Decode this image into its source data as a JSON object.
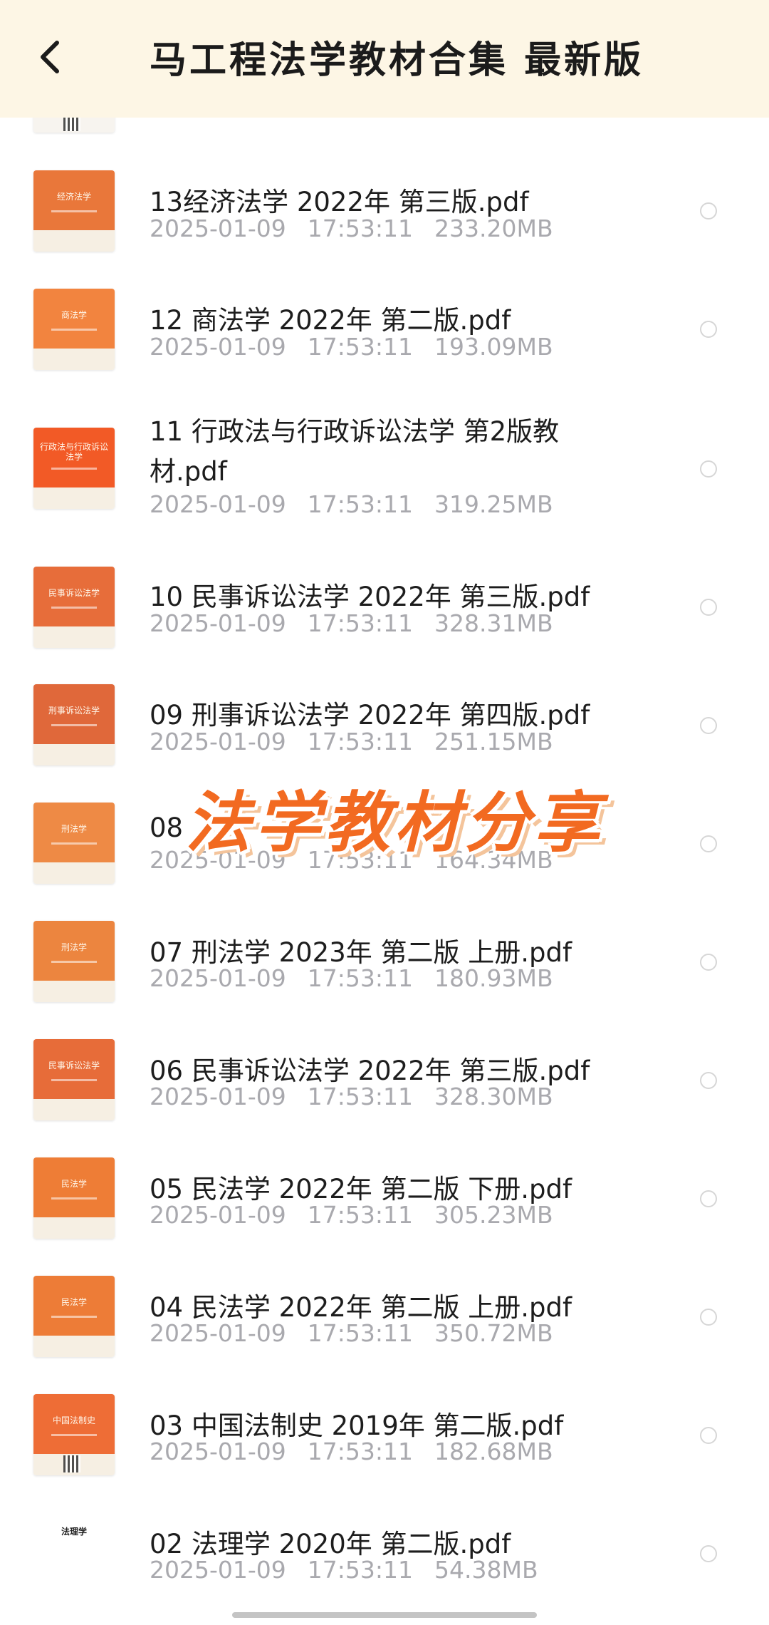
{
  "header": {
    "title": "马工程法学教材合集 最新版",
    "back_icon": "chevron-left-icon"
  },
  "overlay_text": "法学教材分享",
  "files": [
    {
      "name": "13经济法学 2022年 第三版.pdf",
      "date": "2025-01-09",
      "time": "17:53:11",
      "size": "233.20MB",
      "cover_title": "经济法学",
      "cover_color": "#e9773a"
    },
    {
      "name": "12 商法学 2022年 第二版.pdf",
      "date": "2025-01-09",
      "time": "17:53:11",
      "size": "193.09MB",
      "cover_title": "商法学",
      "cover_color": "#f2843f"
    },
    {
      "name": "11 行政法与行政诉讼法学 第2版教材.pdf",
      "date": "2025-01-09",
      "time": "17:53:11",
      "size": "319.25MB",
      "cover_title": "行政法与行政诉讼法学",
      "cover_color": "#f25a26"
    },
    {
      "name": "10 民事诉讼法学 2022年 第三版.pdf",
      "date": "2025-01-09",
      "time": "17:53:11",
      "size": "328.31MB",
      "cover_title": "民事诉讼法学",
      "cover_color": "#e76d3a"
    },
    {
      "name": "09 刑事诉讼法学 2022年 第四版.pdf",
      "date": "2025-01-09",
      "time": "17:53:11",
      "size": "251.15MB",
      "cover_title": "刑事诉讼法学",
      "cover_color": "#e0683a"
    },
    {
      "name": "08",
      "date": "2025-01-09",
      "time": "17:53:11",
      "size": "164.34MB",
      "cover_title": "刑法学",
      "cover_color": "#ee8a45"
    },
    {
      "name": "07 刑法学 2023年 第二版 上册.pdf",
      "date": "2025-01-09",
      "time": "17:53:11",
      "size": "180.93MB",
      "cover_title": "刑法学",
      "cover_color": "#ec853f"
    },
    {
      "name": "06 民事诉讼法学 2022年 第三版.pdf",
      "date": "2025-01-09",
      "time": "17:53:11",
      "size": "328.30MB",
      "cover_title": "民事诉讼法学",
      "cover_color": "#e76c39"
    },
    {
      "name": "05 民法学 2022年 第二版 下册.pdf",
      "date": "2025-01-09",
      "time": "17:53:11",
      "size": "305.23MB",
      "cover_title": "民法学",
      "cover_color": "#ee7d36"
    },
    {
      "name": "04 民法学 2022年 第二版 上册.pdf",
      "date": "2025-01-09",
      "time": "17:53:11",
      "size": "350.72MB",
      "cover_title": "民法学",
      "cover_color": "#ed7c37"
    },
    {
      "name": "03 中国法制史 2019年 第二版.pdf",
      "date": "2025-01-09",
      "time": "17:53:11",
      "size": "182.68MB",
      "cover_title": "中国法制史",
      "cover_color": "#ee6d36"
    },
    {
      "name": "02 法理学 2020年 第二版.pdf",
      "date": "2025-01-09",
      "time": "17:53:11",
      "size": "54.38MB",
      "cover_title": "法理学",
      "cover_color": "#ffffff"
    }
  ]
}
